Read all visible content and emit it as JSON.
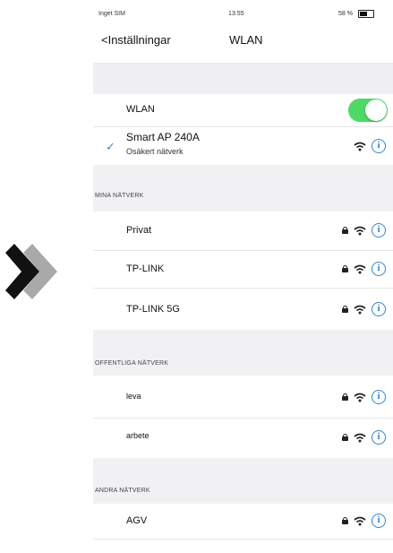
{
  "status_bar": {
    "carrier": "Inget SIM",
    "time": "13:55",
    "battery": "58 %"
  },
  "nav": {
    "back_label": "<Inställningar",
    "title": "WLAN"
  },
  "wlan": {
    "label": "WLAN",
    "enabled": true
  },
  "connected": {
    "name": "Smart AP 240A",
    "subtitle": "Osäkert nätverk"
  },
  "sections": {
    "my_networks": "MINA NÄTVERK",
    "public_networks": "OFFENTLIGA NÄTVERK",
    "other_networks": "ANDRA NÄTVERK"
  },
  "my_networks": [
    {
      "name": "Privat",
      "locked": true
    },
    {
      "name": "TP-LINK",
      "locked": true
    },
    {
      "name": "TP-LINK 5G",
      "locked": true
    }
  ],
  "public_networks": [
    {
      "name": "leva",
      "locked": true
    },
    {
      "name": "arbete",
      "locked": true
    }
  ],
  "other_networks": [
    {
      "name": "AGV",
      "locked": true
    }
  ],
  "colors": {
    "toggle_on": "#4cd964",
    "info_blue": "#2f86d6",
    "group_bg": "#efeff4",
    "chevron_dark": "#111111",
    "chevron_light": "#a9a9a9"
  },
  "icons": {
    "info": "i"
  }
}
